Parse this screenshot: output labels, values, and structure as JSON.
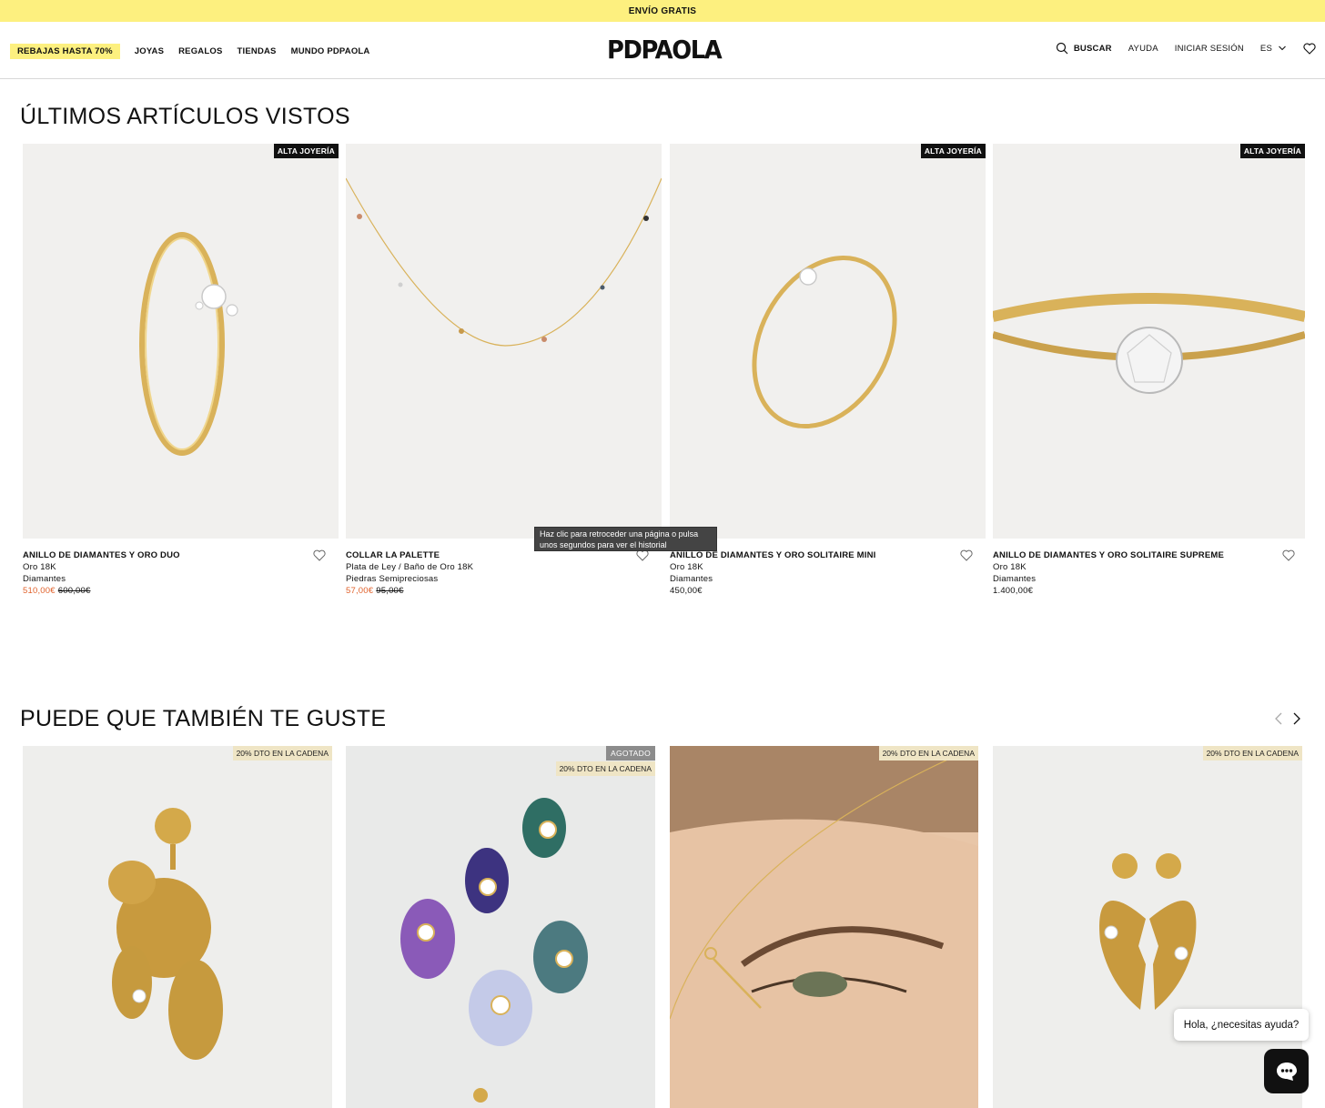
{
  "topbar": {
    "text": "ENVÍO GRATIS"
  },
  "header": {
    "nav_left": [
      "REBAJAS HASTA 70%",
      "JOYAS",
      "REGALOS",
      "TIENDAS",
      "MUNDO PDPAOLA"
    ],
    "logo": "PDPAOLA",
    "search_label": "BUSCAR",
    "help_label": "AYUDA",
    "login_label": "INICIAR SESIÓN",
    "lang_label": "ES"
  },
  "recent": {
    "title": "ÚLTIMOS ARTÍCULOS VISTOS",
    "products": [
      {
        "badge": "ALTA JOYERÍA",
        "name": "ANILLO DE DIAMANTES Y ORO DUO",
        "line1": "Oro 18K",
        "line2": "Diamantes",
        "price": "510,00€",
        "old_price": "600,00€"
      },
      {
        "badge": "",
        "name": "COLLAR LA PALETTE",
        "line1": "Plata de Ley / Baño de Oro 18K",
        "line2": "Piedras Semipreciosas",
        "price": "57,00€",
        "old_price": "95,00€"
      },
      {
        "badge": "ALTA JOYERÍA",
        "name": "ANILLO DE DIAMANTES Y ORO SOLITAIRE MINI",
        "line1": "Oro 18K",
        "line2": "Diamantes",
        "price": "450,00€",
        "old_price": ""
      },
      {
        "badge": "ALTA JOYERÍA",
        "name": "ANILLO DE DIAMANTES Y ORO SOLITAIRE SUPREME",
        "line1": "Oro 18K",
        "line2": "Diamantes",
        "price": "1.400,00€",
        "old_price": ""
      }
    ]
  },
  "tooltip": {
    "text": "Haz clic para retroceder una página o pulsa unos segundos para ver el historial"
  },
  "suggest": {
    "title": "PUEDE QUE TAMBIÉN TE GUSTE",
    "products": [
      {
        "status": "",
        "badge": "20% DTO EN LA CADENA"
      },
      {
        "status": "AGOTADO",
        "badge": "20% DTO EN LA CADENA"
      },
      {
        "status": "",
        "badge": "20% DTO EN LA CADENA"
      },
      {
        "status": "",
        "badge": "20% DTO EN LA CADENA"
      }
    ]
  },
  "chat": {
    "greeting": "Hola, ¿necesitas ayuda?"
  },
  "colors": {
    "accent_yellow": "#fdf07f",
    "sale_orange": "#e0612b",
    "badge_beige": "#efe5c5",
    "gold": "#d9b25a"
  }
}
